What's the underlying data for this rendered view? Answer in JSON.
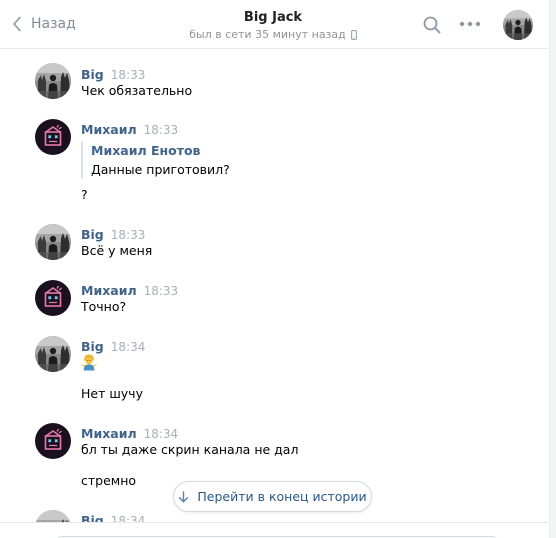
{
  "header": {
    "back_label": "Назад",
    "title": "Big Jack",
    "status": "был в сети 35 минут назад"
  },
  "messages": [
    {
      "author": "Big",
      "time": "18:33",
      "lines": [
        "Чек обязательно"
      ]
    },
    {
      "author": "Михаил",
      "time": "18:33",
      "quote": {
        "author": "Михаил Енотов",
        "text": "Данные приготовил?"
      },
      "lines": [
        "?"
      ]
    },
    {
      "author": "Big",
      "time": "18:33",
      "lines": [
        "Всё у меня"
      ]
    },
    {
      "author": "Михаил",
      "time": "18:33",
      "lines": [
        "Точно?"
      ]
    },
    {
      "author": "Big",
      "time": "18:34",
      "emoji": "person-shrugging-emoji",
      "lines": [
        "Нет шучу"
      ]
    },
    {
      "author": "Михаил",
      "time": "18:34",
      "lines": [
        "бл ты даже скрин канала не дал",
        "стремно"
      ]
    },
    {
      "author": "Big",
      "time": "18:34",
      "lines": []
    }
  ],
  "jump_button": {
    "label": "Перейти в конец истории"
  },
  "icons": {
    "back": "chevron-left-icon",
    "search": "search-icon",
    "more": "more-horizontal-icon",
    "mobile": "mobile-phone-icon",
    "jump": "arrow-down-icon"
  },
  "colors": {
    "author_link": "#42648b",
    "time": "#a9afb8",
    "muted": "#818c99",
    "accent": "#2a5885",
    "border": "#e7e8ec"
  }
}
